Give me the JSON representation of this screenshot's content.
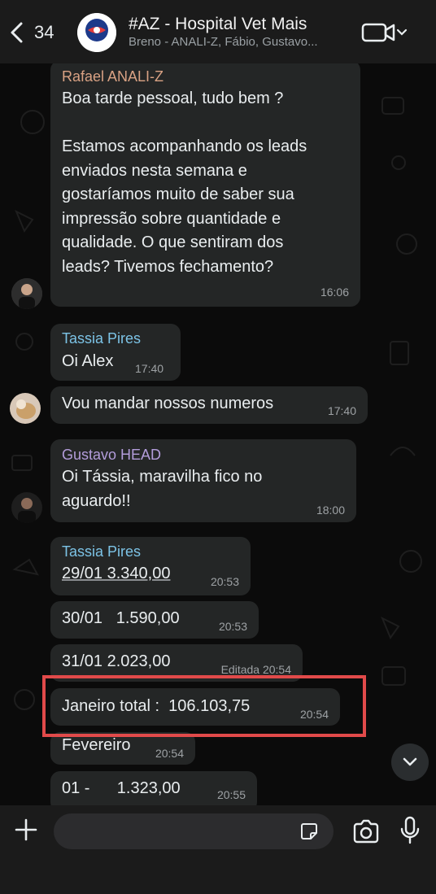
{
  "header": {
    "back_count": "34",
    "title": "#AZ - Hospital Vet Mais",
    "subtitle": "Breno - ANALI-Z, Fábio, Gustavo...",
    "avatar_label": "ANALI-Z"
  },
  "messages": [
    {
      "sender": "Rafael ANALI-Z",
      "sender_color": "#d9a284",
      "text": "Boa tarde pessoal, tudo bem ?\n\nEstamos acompanhando os leads\nenviados nesta semana e\ngostaríamos muito de saber sua\nimpressão sobre quantidade e\nqualidade. O que sentiram dos\nleads? Tivemos fechamento?",
      "time": "16:06"
    },
    {
      "sender": "Tassia Pires",
      "sender_color": "#7cc3e6",
      "text": "Oi Alex",
      "time": "17:40"
    },
    {
      "text": "Vou mandar nossos numeros",
      "time": "17:40"
    },
    {
      "sender": "Gustavo HEAD",
      "sender_color": "#b39ddb",
      "text": "Oi Tássia, maravilha fico no\naguardo!!",
      "time": "18:00"
    },
    {
      "sender": "Tassia Pires",
      "sender_color": "#7cc3e6",
      "text": "29/01 3.340,00",
      "time": "20:53"
    },
    {
      "text": "30/01   1.590,00",
      "time": "20:53"
    },
    {
      "text": "31/01 2.023,00",
      "time": "Editada 20:54"
    },
    {
      "text": "Janeiro total :  106.103,75",
      "time": "20:54"
    },
    {
      "text": "Fevereiro",
      "time": "20:54"
    },
    {
      "text": "01 -      1.323,00",
      "time": "20:55"
    }
  ],
  "colors": {
    "background": "#0b0b0b",
    "bubble": "#242626",
    "highlight": "#e14a4a"
  },
  "icons": [
    "chevron-left-icon",
    "video-call-icon",
    "chevron-down-icon",
    "plus-icon",
    "sticker-icon",
    "camera-icon",
    "microphone-icon"
  ]
}
